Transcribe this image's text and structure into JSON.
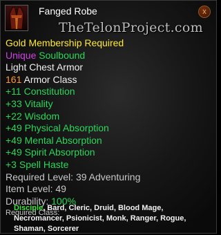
{
  "item": {
    "name": "Fanged Robe",
    "icon": "robe-icon",
    "membership": "Gold Membership Required",
    "flags": {
      "unique": "Unique",
      "soulbound": "Soulbound"
    },
    "slot": "Light Chest Armor",
    "armor_value": "161",
    "armor_label": " Armor Class",
    "stats": [
      "+11 Constitution",
      "+33 Vitality",
      "+22 Wisdom",
      "+49 Physical Absorption",
      "+49 Mental Absorption",
      "+49 Spirit Absorption",
      "+3 Spell Haste"
    ],
    "required_level": "Required Level: 39 Adventuring",
    "item_level": "Item Level: 49",
    "durability_label": "Durability: ",
    "durability_value": "100%",
    "required_class_label": "Required Class:",
    "classes_highlight": "Disciple",
    "classes_rest_1": ", Bard, Cleric, Druid, Blood Mage,",
    "classes_rest_2": "Necromancer, Psionicist, Monk, Ranger, Rogue,",
    "classes_rest_3": "Shaman, Sorcerer"
  },
  "watermark": "TheTelonProject.com",
  "close_label": "x",
  "colors": {
    "gold": "#ffea32",
    "unique": "#d040e6",
    "green": "#2ad65a",
    "durability": "#2ad65a",
    "armor_value": "#ff9a30"
  }
}
